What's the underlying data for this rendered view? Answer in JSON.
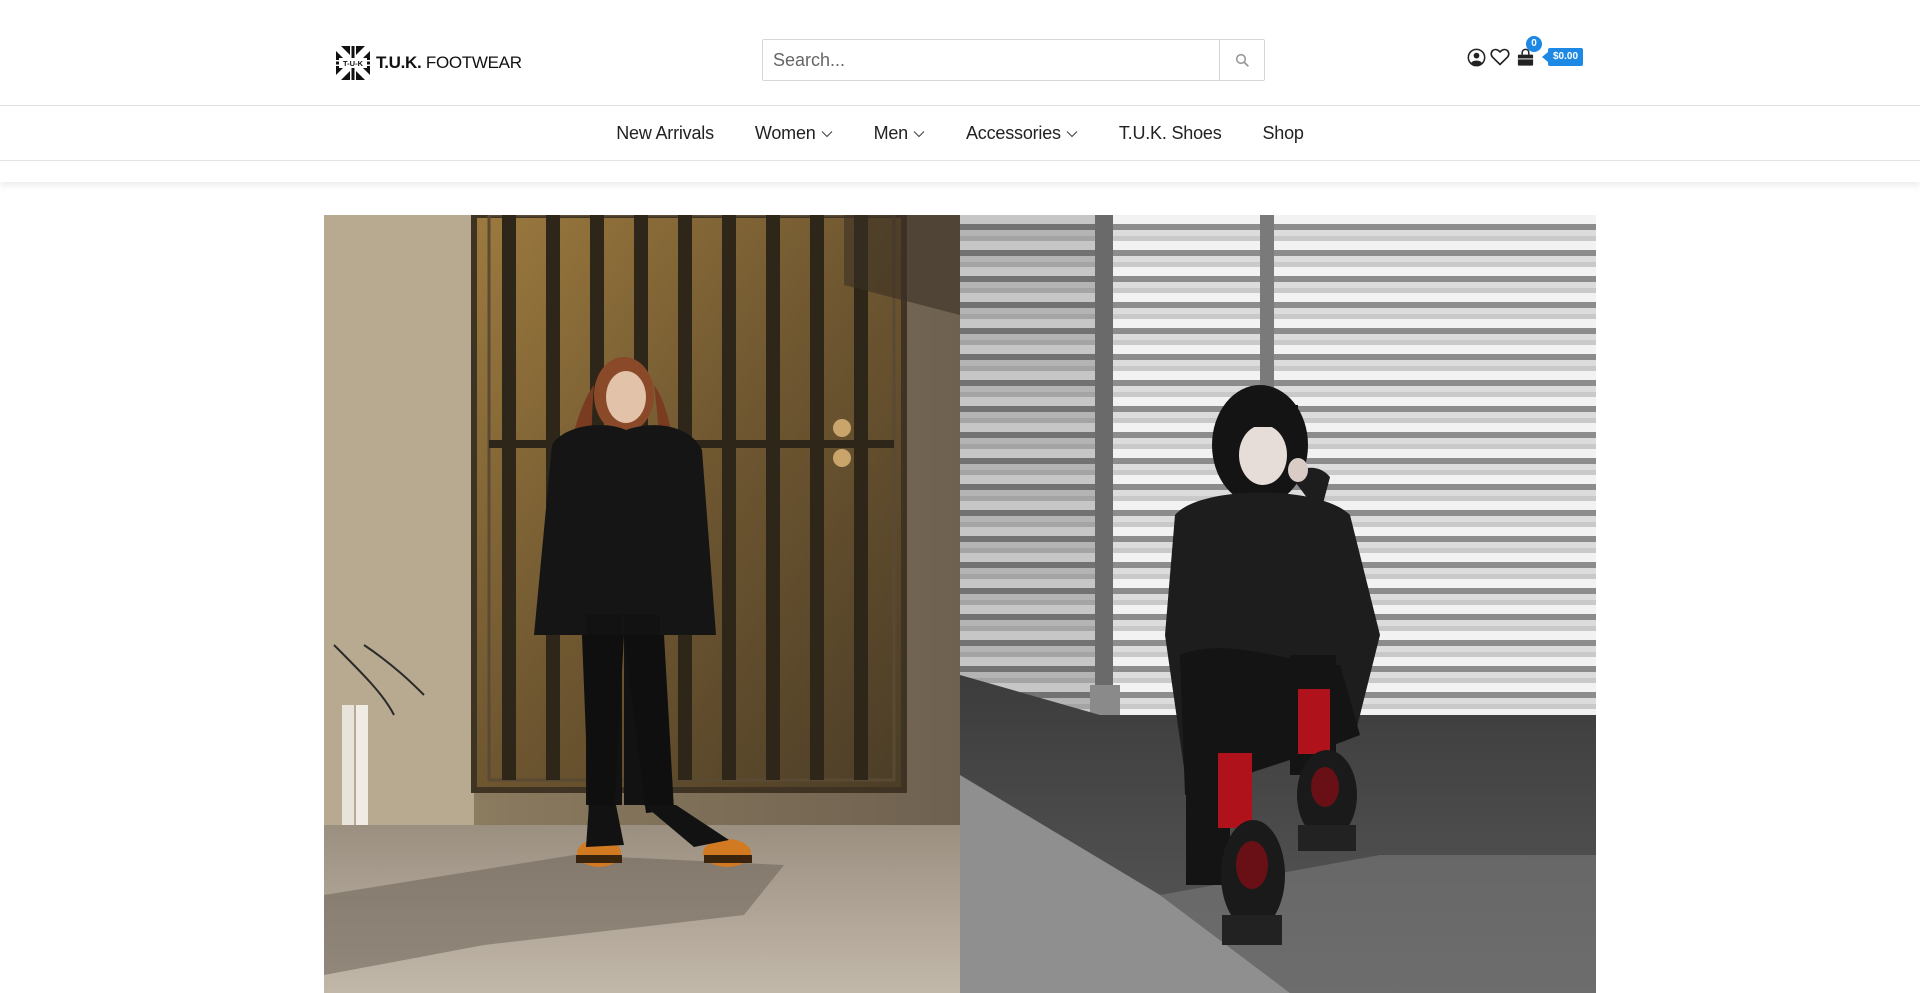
{
  "brand": {
    "name_bold": "T.U.K.",
    "name_light": "FOOTWEAR",
    "mark_text": "T-U-K"
  },
  "search": {
    "placeholder": "Search...",
    "value": ""
  },
  "header_icons": {
    "account_icon": "user-circle-icon",
    "wishlist_icon": "heart-icon",
    "cart_icon": "shopping-bag-icon",
    "cart_count": "0",
    "cart_total": "$0.00",
    "accent_color": "#1e88e5"
  },
  "nav": {
    "items": [
      {
        "label": "New Arrivals",
        "has_dropdown": false
      },
      {
        "label": "Women",
        "has_dropdown": true
      },
      {
        "label": "Men",
        "has_dropdown": true
      },
      {
        "label": "Accessories",
        "has_dropdown": true
      },
      {
        "label": "T.U.K. Shoes",
        "has_dropdown": false
      },
      {
        "label": "Shop",
        "has_dropdown": false
      }
    ]
  }
}
